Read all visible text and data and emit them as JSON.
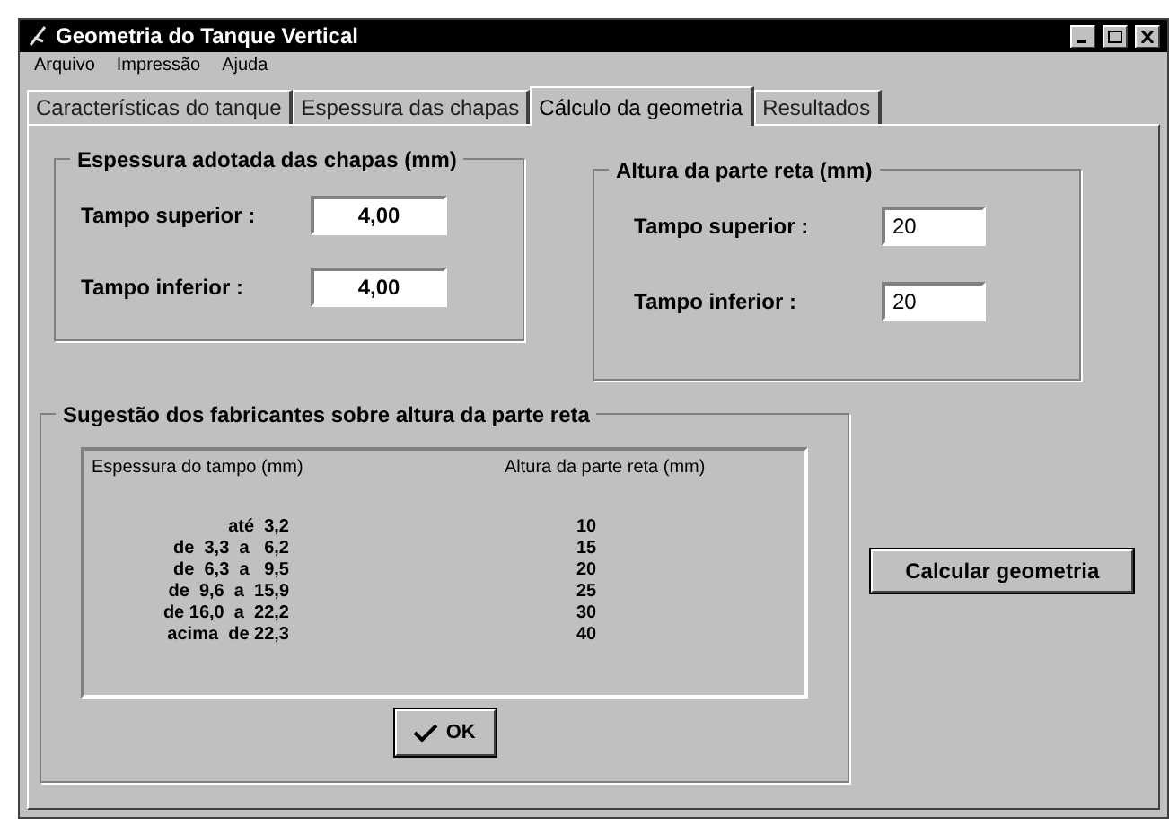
{
  "window": {
    "title": "Geometria do Tanque Vertical"
  },
  "menu": [
    "Arquivo",
    "Impressão",
    "Ajuda"
  ],
  "tabs": [
    {
      "label": "Características do tanque",
      "selected": false
    },
    {
      "label": "Espessura das chapas",
      "selected": false
    },
    {
      "label": "Cálculo da geometria",
      "selected": true
    },
    {
      "label": "Resultados",
      "selected": false
    }
  ],
  "thickness_group": {
    "title": "Espessura adotada das chapas (mm)",
    "fields": [
      {
        "label": "Tampo superior :",
        "value": "4,00"
      },
      {
        "label": "Tampo inferior :",
        "value": "4,00"
      }
    ]
  },
  "height_group": {
    "title": "Altura da parte reta (mm)",
    "fields": [
      {
        "label": "Tampo superior :",
        "value": "20"
      },
      {
        "label": "Tampo inferior :",
        "value": "20"
      }
    ]
  },
  "suggestion_group": {
    "title": "Sugestão dos fabricantes sobre altura da parte reta",
    "columns": [
      "Espessura do tampo (mm)",
      "Altura da parte reta (mm)"
    ],
    "rows": [
      [
        "até  3,2",
        "10"
      ],
      [
        "de  3,3  a   6,2",
        "15"
      ],
      [
        "de  6,3  a   9,5",
        "20"
      ],
      [
        "de  9,6  a  15,9",
        "25"
      ],
      [
        "de 16,0  a  22,2",
        "30"
      ],
      [
        "acima  de 22,3",
        "40"
      ]
    ],
    "ok_button": "OK"
  },
  "calculate_button": "Calcular geometria"
}
